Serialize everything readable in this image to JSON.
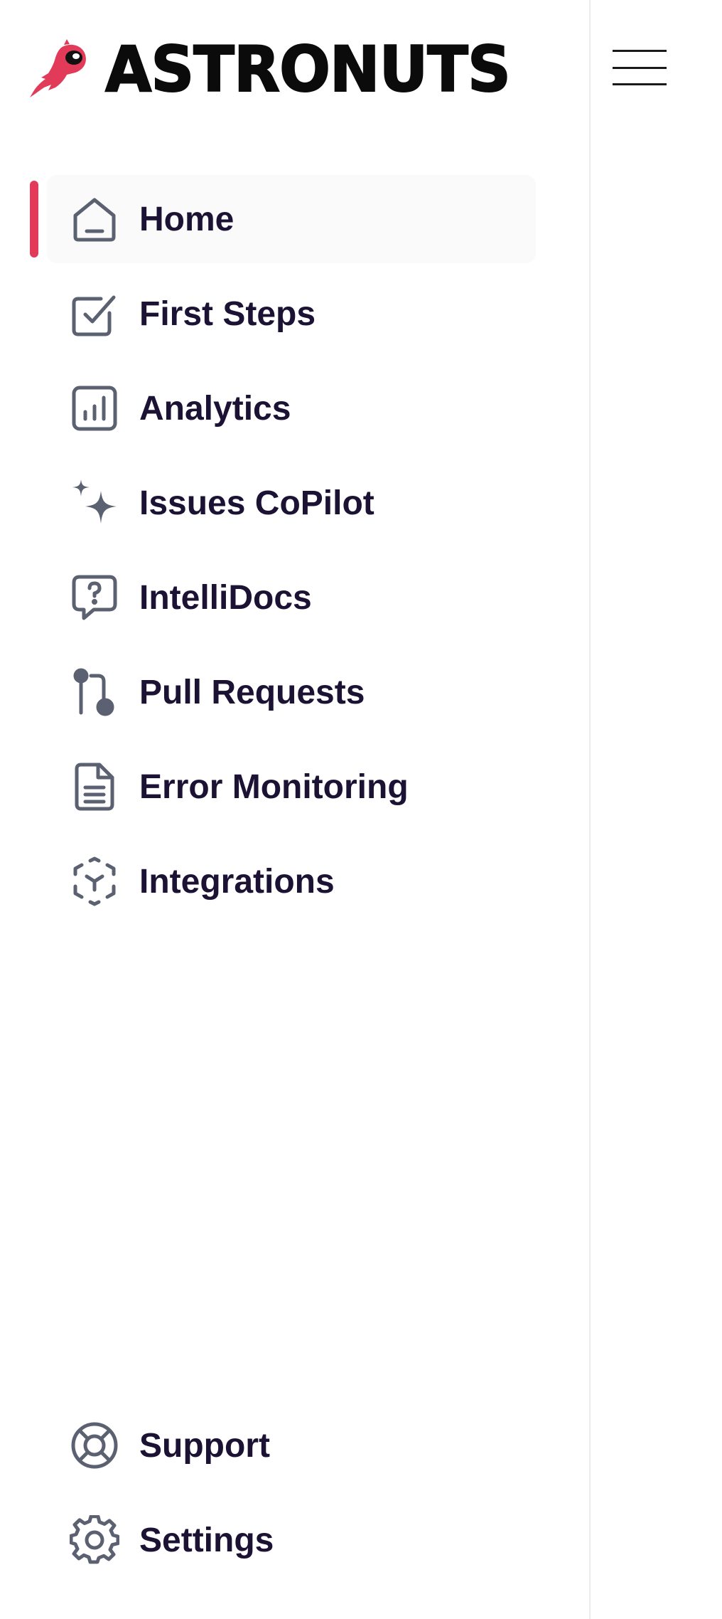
{
  "brand": {
    "name": "ASTRONUTS",
    "logo_icon": "astronaut-logo-icon",
    "accent_color": "#e23b5a",
    "text_color": "#1c1234",
    "icon_color": "#5b6170"
  },
  "header": {
    "menu_icon": "hamburger-menu-icon"
  },
  "sidebar": {
    "active_item": "Home",
    "items": [
      {
        "label": "Home",
        "icon": "home-icon"
      },
      {
        "label": "First Steps",
        "icon": "checkbox-icon"
      },
      {
        "label": "Analytics",
        "icon": "bar-chart-icon"
      },
      {
        "label": "Issues CoPilot",
        "icon": "sparkles-icon"
      },
      {
        "label": "IntelliDocs",
        "icon": "question-chat-icon"
      },
      {
        "label": "Pull Requests",
        "icon": "git-pull-request-icon"
      },
      {
        "label": "Error Monitoring",
        "icon": "document-icon"
      },
      {
        "label": "Integrations",
        "icon": "cube-dashed-icon"
      }
    ],
    "footer_items": [
      {
        "label": "Support",
        "icon": "lifebuoy-icon"
      },
      {
        "label": "Settings",
        "icon": "gear-icon"
      }
    ]
  }
}
